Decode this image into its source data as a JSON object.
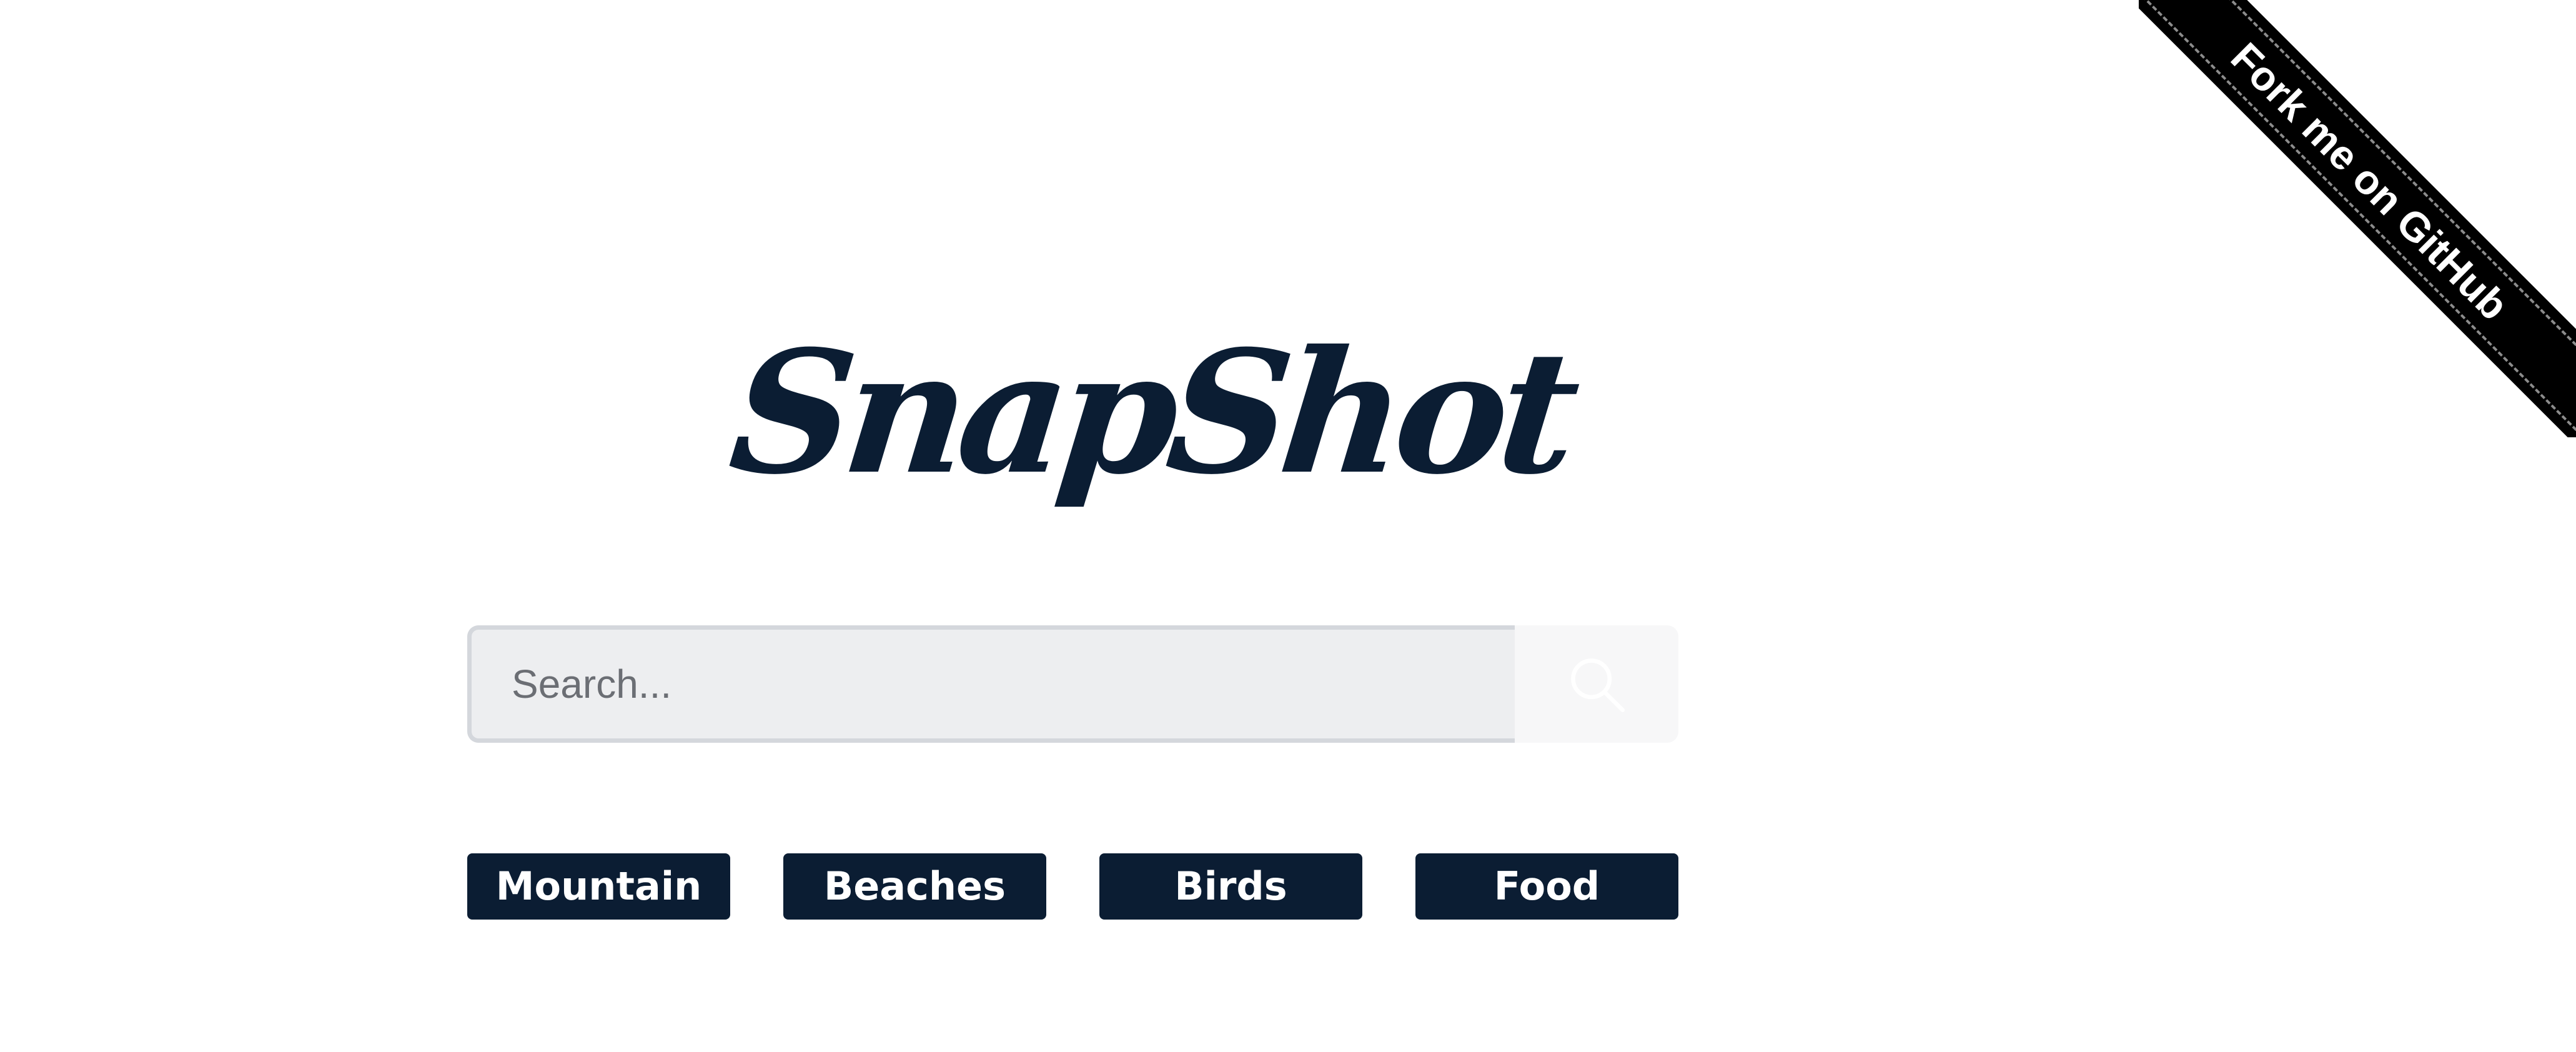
{
  "logo": {
    "text": "SnapShot"
  },
  "search": {
    "placeholder": "Search...",
    "value": "",
    "button_icon": "search-icon"
  },
  "categories": [
    {
      "label": "Mountain"
    },
    {
      "label": "Beaches"
    },
    {
      "label": "Birds"
    },
    {
      "label": "Food"
    }
  ],
  "ribbon": {
    "label": "Fork me on GitHub"
  },
  "colors": {
    "brand_dark": "#0b1d33",
    "search_bg": "#edeef0",
    "search_border": "#d4d7dc",
    "ribbon_bg": "#000000"
  }
}
